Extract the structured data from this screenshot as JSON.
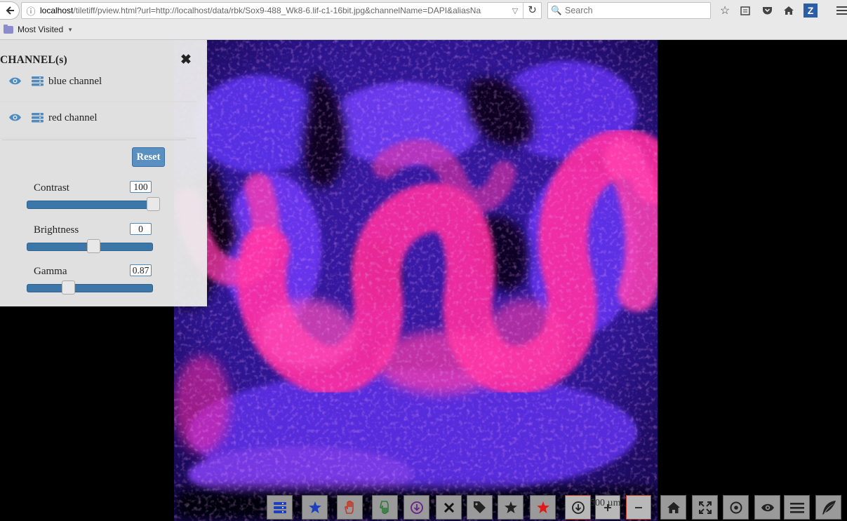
{
  "browser": {
    "url_host": "localhost",
    "url_path": "/tiletiff/pview.html?url=http://localhost/data/rbk/Sox9-488_Wk8-6.lif-c1-16bit.jpg&channelName=DAPI&aliasNa",
    "search_placeholder": "Search",
    "bookmark_folder": "Most Visited",
    "zotero_label": "Z"
  },
  "panel": {
    "title": "CHANNEL(s)",
    "channels": [
      {
        "label": "blue channel"
      },
      {
        "label": "red channel"
      }
    ],
    "reset_label": "Reset",
    "sliders": [
      {
        "label": "Contrast",
        "value": "100",
        "fraction": 1.0
      },
      {
        "label": "Brightness",
        "value": "0",
        "fraction": 0.5
      },
      {
        "label": "Gamma",
        "value": "0.87",
        "fraction": 0.29
      }
    ]
  },
  "toolbar": {
    "scale_label": "500 µm",
    "icons": [
      "layers-icon",
      "star-icon",
      "hand-icon",
      "hand-outline-icon",
      "download-circle-icon",
      "close-icon",
      "tag-icon",
      "star-icon",
      "red-star-icon",
      "download-icon",
      "zoom-in-icon",
      "zoom-out-icon",
      "home-icon",
      "fullscreen-icon",
      "target-icon",
      "eye-icon",
      "menu-icon",
      "feather-icon"
    ]
  },
  "colors": {
    "slider_fill": "#3d77a9",
    "reset_bg": "#5a8fc2",
    "tissue_magenta": "#ff2c9e",
    "tissue_blue": "#5a2fe0"
  }
}
